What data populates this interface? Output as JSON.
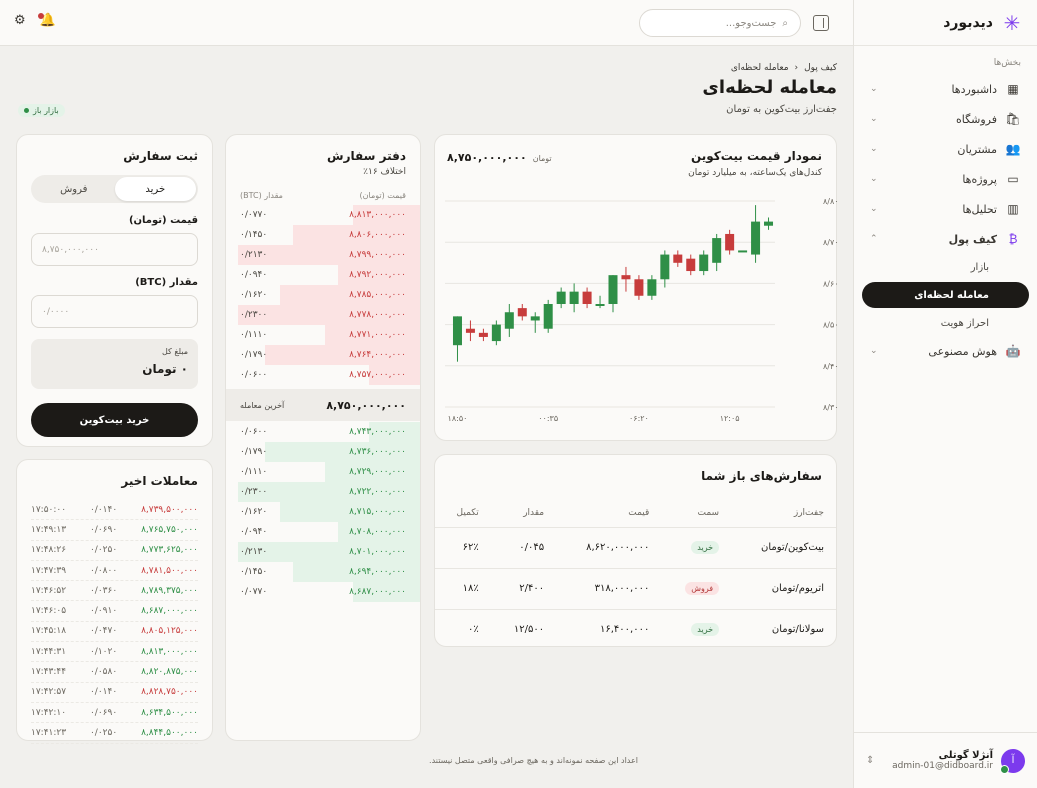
{
  "brand": {
    "name": "دیدبورد"
  },
  "sidebar": {
    "section_label": "بخش‌ها",
    "items": [
      {
        "label": "داشبوردها"
      },
      {
        "label": "فروشگاه"
      },
      {
        "label": "مشتریان"
      },
      {
        "label": "پروژه‌ها"
      },
      {
        "label": "تحلیل‌ها"
      },
      {
        "label": "کیف پول"
      },
      {
        "label": "هوش مصنوعی"
      }
    ],
    "wallet_sub": [
      {
        "label": "بازار"
      },
      {
        "label": "معامله لحظه‌ای"
      },
      {
        "label": "احراز هویت"
      }
    ]
  },
  "user": {
    "name": "آنژلا گوتلی",
    "email": "admin-01@didboard.ir",
    "initial": "آ"
  },
  "topbar": {
    "search_placeholder": "جست‌وجو..."
  },
  "page": {
    "breadcrumb": [
      "کیف پول",
      "معامله لحظه‌ای"
    ],
    "title": "معامله لحظه‌ای",
    "subtitle": "جفت‌ارز بیت‌کوین به تومان",
    "market_status": "بازار باز"
  },
  "chart": {
    "title": "نمودار قیمت بیت‌کوین",
    "subtitle": "کندل‌های یک‌ساعته، به میلیارد تومان",
    "price": "۸,۷۵۰,۰۰۰,۰۰۰",
    "currency": "تومان",
    "colors": {
      "up": "#2f8f47",
      "down": "#c73c3c"
    }
  },
  "chart_data": {
    "type": "candlestick",
    "ylabel_unit": "میلیارد",
    "y_ticks": [
      8.3,
      8.4,
      8.5,
      8.6,
      8.7,
      8.8
    ],
    "y_tick_labels": [
      "میلیارد ۸/۳۰",
      "میلیارد ۸/۴۰",
      "میلیارد ۸/۵۰",
      "میلیارد ۸/۶۰",
      "میلیارد ۸/۷۰",
      "میلیارد ۸/۸۰"
    ],
    "ylim": [
      8.3,
      8.8
    ],
    "x_tick_labels": [
      "۱۸:۵۰",
      "۰۰:۳۵",
      "۰۶:۲۰",
      "۱۲:۰۵"
    ],
    "x_tick_index": [
      0,
      7,
      14,
      21
    ],
    "candles": [
      {
        "o": 8.45,
        "h": 8.52,
        "l": 8.41,
        "c": 8.52
      },
      {
        "o": 8.49,
        "h": 8.51,
        "l": 8.46,
        "c": 8.48
      },
      {
        "o": 8.48,
        "h": 8.49,
        "l": 8.46,
        "c": 8.47
      },
      {
        "o": 8.46,
        "h": 8.51,
        "l": 8.45,
        "c": 8.5
      },
      {
        "o": 8.49,
        "h": 8.55,
        "l": 8.47,
        "c": 8.53
      },
      {
        "o": 8.54,
        "h": 8.55,
        "l": 8.51,
        "c": 8.52
      },
      {
        "o": 8.51,
        "h": 8.53,
        "l": 8.48,
        "c": 8.52
      },
      {
        "o": 8.49,
        "h": 8.56,
        "l": 8.48,
        "c": 8.55
      },
      {
        "o": 8.55,
        "h": 8.59,
        "l": 8.54,
        "c": 8.58
      },
      {
        "o": 8.55,
        "h": 8.6,
        "l": 8.53,
        "c": 8.58
      },
      {
        "o": 8.58,
        "h": 8.59,
        "l": 8.54,
        "c": 8.55
      },
      {
        "o": 8.55,
        "h": 8.57,
        "l": 8.54,
        "c": 8.55
      },
      {
        "o": 8.55,
        "h": 8.62,
        "l": 8.53,
        "c": 8.62
      },
      {
        "o": 8.62,
        "h": 8.64,
        "l": 8.58,
        "c": 8.61
      },
      {
        "o": 8.61,
        "h": 8.62,
        "l": 8.56,
        "c": 8.57
      },
      {
        "o": 8.57,
        "h": 8.62,
        "l": 8.56,
        "c": 8.61
      },
      {
        "o": 8.61,
        "h": 8.68,
        "l": 8.59,
        "c": 8.67
      },
      {
        "o": 8.67,
        "h": 8.68,
        "l": 8.64,
        "c": 8.65
      },
      {
        "o": 8.66,
        "h": 8.67,
        "l": 8.62,
        "c": 8.63
      },
      {
        "o": 8.63,
        "h": 8.68,
        "l": 8.62,
        "c": 8.67
      },
      {
        "o": 8.65,
        "h": 8.72,
        "l": 8.63,
        "c": 8.71
      },
      {
        "o": 8.72,
        "h": 8.73,
        "l": 8.67,
        "c": 8.68
      },
      {
        "o": 8.68,
        "h": 8.68,
        "l": 8.68,
        "c": 8.68
      },
      {
        "o": 8.67,
        "h": 8.79,
        "l": 8.65,
        "c": 8.75
      },
      {
        "o": 8.74,
        "h": 8.76,
        "l": 8.73,
        "c": 8.75
      }
    ]
  },
  "open_orders": {
    "title": "سفارش‌های باز شما",
    "headers": [
      "جفت‌ارز",
      "سمت",
      "قیمت",
      "مقدار",
      "تکمیل"
    ],
    "rows": [
      {
        "pair": "بیت‌کوین/تومان",
        "side": "خرید",
        "side_type": "buy",
        "price": "۸,۶۲۰,۰۰۰,۰۰۰",
        "amount": "۰/۰۴۵",
        "filled": "۶۲٪"
      },
      {
        "pair": "اتریوم/تومان",
        "side": "فروش",
        "side_type": "sell",
        "price": "۳۱۸,۰۰۰,۰۰۰",
        "amount": "۲/۴۰۰",
        "filled": "۱۸٪"
      },
      {
        "pair": "سولانا/تومان",
        "side": "خرید",
        "side_type": "buy",
        "price": "۱۶,۴۰۰,۰۰۰",
        "amount": "۱۲/۵۰۰",
        "filled": "۰٪"
      }
    ]
  },
  "order_book": {
    "title": "دفتر سفارش",
    "spread": "اختلاف ۱۶٪",
    "col_price": "قیمت (تومان)",
    "col_qty": "مقدار (BTC)",
    "asks": [
      {
        "p": "۸,۸۱۳,۰۰۰,۰۰۰",
        "q": "۰/۰۷۷۰",
        "depth": 0.37
      },
      {
        "p": "۸,۸۰۶,۰۰۰,۰۰۰",
        "q": "۰/۱۴۵۰",
        "depth": 0.7
      },
      {
        "p": "۸,۷۹۹,۰۰۰,۰۰۰",
        "q": "۰/۲۱۳۰",
        "depth": 1.0
      },
      {
        "p": "۸,۷۹۲,۰۰۰,۰۰۰",
        "q": "۰/۰۹۴۰",
        "depth": 0.45
      },
      {
        "p": "۸,۷۸۵,۰۰۰,۰۰۰",
        "q": "۰/۱۶۲۰",
        "depth": 0.77
      },
      {
        "p": "۸,۷۷۸,۰۰۰,۰۰۰",
        "q": "۰/۲۳۰۰",
        "depth": 1.0
      },
      {
        "p": "۸,۷۷۱,۰۰۰,۰۰۰",
        "q": "۰/۱۱۱۰",
        "depth": 0.52
      },
      {
        "p": "۸,۷۶۴,۰۰۰,۰۰۰",
        "q": "۰/۱۷۹۰",
        "depth": 0.85
      },
      {
        "p": "۸,۷۵۷,۰۰۰,۰۰۰",
        "q": "۰/۰۶۰۰",
        "depth": 0.28
      }
    ],
    "last_trade_value": "۸,۷۵۰,۰۰۰,۰۰۰",
    "last_trade_label": "آخرین معامله",
    "bids": [
      {
        "p": "۸,۷۴۳,۰۰۰,۰۰۰",
        "q": "۰/۰۶۰۰",
        "depth": 0.28
      },
      {
        "p": "۸,۷۳۶,۰۰۰,۰۰۰",
        "q": "۰/۱۷۹۰",
        "depth": 0.85
      },
      {
        "p": "۸,۷۲۹,۰۰۰,۰۰۰",
        "q": "۰/۱۱۱۰",
        "depth": 0.52
      },
      {
        "p": "۸,۷۲۲,۰۰۰,۰۰۰",
        "q": "۰/۲۳۰۰",
        "depth": 1.0
      },
      {
        "p": "۸,۷۱۵,۰۰۰,۰۰۰",
        "q": "۰/۱۶۲۰",
        "depth": 0.77
      },
      {
        "p": "۸,۷۰۸,۰۰۰,۰۰۰",
        "q": "۰/۰۹۴۰",
        "depth": 0.45
      },
      {
        "p": "۸,۷۰۱,۰۰۰,۰۰۰",
        "q": "۰/۲۱۳۰",
        "depth": 1.0
      },
      {
        "p": "۸,۶۹۴,۰۰۰,۰۰۰",
        "q": "۰/۱۴۵۰",
        "depth": 0.7
      },
      {
        "p": "۸,۶۸۷,۰۰۰,۰۰۰",
        "q": "۰/۰۷۷۰",
        "depth": 0.37
      }
    ]
  },
  "order_form": {
    "title": "ثبت سفارش",
    "tab_buy": "خرید",
    "tab_sell": "فروش",
    "price_label": "قیمت (تومان)",
    "price_placeholder": "۸,۷۵۰,۰۰۰,۰۰۰",
    "amount_label": "مقدار (BTC)",
    "amount_placeholder": "۰/۰۰۰۰",
    "total_label": "مبلغ کل",
    "total_value": "۰ تومان",
    "submit": "خرید بیت‌کوین"
  },
  "recent_trades": {
    "title": "معاملات اخیر",
    "rows": [
      {
        "p": "۸,۷۳۹,۵۰۰,۰۰۰",
        "q": "۰/۰۱۴۰",
        "t": "۱۷:۵۰:۰۰",
        "dir": "down"
      },
      {
        "p": "۸,۷۶۵,۷۵۰,۰۰۰",
        "q": "۰/۰۶۹۰",
        "t": "۱۷:۴۹:۱۳",
        "dir": "up"
      },
      {
        "p": "۸,۷۷۳,۶۲۵,۰۰۰",
        "q": "۰/۰۲۵۰",
        "t": "۱۷:۴۸:۲۶",
        "dir": "up"
      },
      {
        "p": "۸,۷۸۱,۵۰۰,۰۰۰",
        "q": "۰/۰۸۰۰",
        "t": "۱۷:۴۷:۳۹",
        "dir": "down"
      },
      {
        "p": "۸,۷۸۹,۳۷۵,۰۰۰",
        "q": "۰/۰۳۶۰",
        "t": "۱۷:۴۶:۵۲",
        "dir": "up"
      },
      {
        "p": "۸,۶۸۷,۰۰۰,۰۰۰",
        "q": "۰/۰۹۱۰",
        "t": "۱۷:۴۶:۰۵",
        "dir": "up"
      },
      {
        "p": "۸,۸۰۵,۱۲۵,۰۰۰",
        "q": "۰/۰۴۷۰",
        "t": "۱۷:۴۵:۱۸",
        "dir": "down"
      },
      {
        "p": "۸,۸۱۳,۰۰۰,۰۰۰",
        "q": "۰/۱۰۲۰",
        "t": "۱۷:۴۴:۳۱",
        "dir": "up"
      },
      {
        "p": "۸,۸۲۰,۸۷۵,۰۰۰",
        "q": "۰/۰۵۸۰",
        "t": "۱۷:۴۳:۴۴",
        "dir": "up"
      },
      {
        "p": "۸,۸۲۸,۷۵۰,۰۰۰",
        "q": "۰/۰۱۴۰",
        "t": "۱۷:۴۲:۵۷",
        "dir": "down"
      },
      {
        "p": "۸,۶۳۴,۵۰۰,۰۰۰",
        "q": "۰/۰۶۹۰",
        "t": "۱۷:۴۲:۱۰",
        "dir": "up"
      },
      {
        "p": "۸,۸۴۴,۵۰۰,۰۰۰",
        "q": "۰/۰۲۵۰",
        "t": "۱۷:۴۱:۲۳",
        "dir": "up"
      }
    ]
  },
  "footer": "اعداد این صفحه نمونه‌اند و به هیچ صرافی واقعی متصل نیستند."
}
